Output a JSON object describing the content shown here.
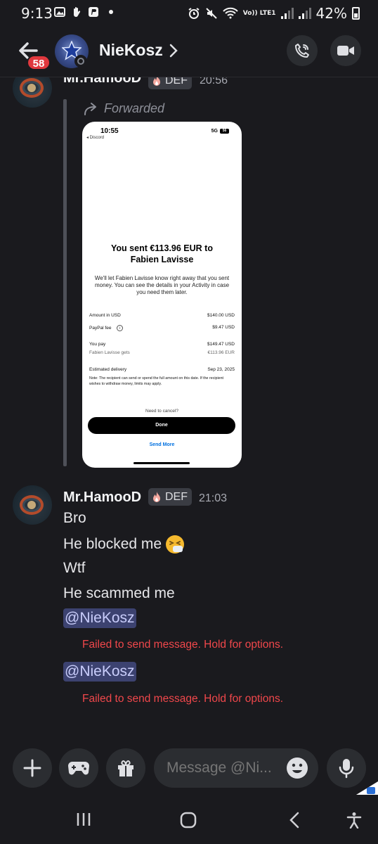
{
  "status_bar": {
    "time": "9:13",
    "battery": "42%",
    "network": "Vo)) LTE1"
  },
  "header": {
    "unread_count": "58",
    "channel_name": "NieKosz",
    "avatar_label": "NIEKOSZ"
  },
  "messages": [
    {
      "author": "Mr.HamooD",
      "role": "DEF",
      "time": "20:56",
      "forwarded_label": "Forwarded",
      "screenshot": {
        "time": "10:55",
        "back_app": "◂ Discord",
        "signal": "5G",
        "battery": "56",
        "title_line1": "You sent €113.96 EUR to",
        "title_line2": "Fabien Lavisse",
        "body": "We'll let Fabien Lavisse know right away that you sent money. You can see the details in your Activity in case you need them later.",
        "rows": [
          {
            "label": "Amount in USD",
            "value": "$140.00 USD"
          },
          {
            "label": "PayPal fee",
            "value": "$9.47 USD"
          },
          {
            "label": "You pay",
            "value": "$149.47 USD"
          },
          {
            "label": "Fabien Lavisse gets",
            "value": "€113.96 EUR"
          },
          {
            "label": "Estimated delivery",
            "value": "Sep 23, 2025"
          }
        ],
        "note": "Note: The recipient can send or spend the full amount on this date. If the recipient wishes to withdraw money, limits may apply.",
        "cancel_text": "Need to cancel?",
        "done_button": "Done",
        "send_more": "Send More"
      }
    },
    {
      "author": "Mr.HamooD",
      "role": "DEF",
      "time": "21:03",
      "lines": [
        "Bro",
        "He blocked me",
        "Wtf",
        "He scammed me"
      ],
      "mentions": [
        {
          "text": "@NieKosz",
          "error": "Failed to send message. Hold for options."
        },
        {
          "text": "@NieKosz",
          "error": "Failed to send message. Hold for options."
        }
      ]
    }
  ],
  "input": {
    "placeholder": "Message @Ni..."
  },
  "colors": {
    "background": "#1a1a1e",
    "badge_red": "#e0383e",
    "error_red": "#f0474b",
    "mention_bg": "#3c4270",
    "button_bg": "#2b2d31"
  },
  "icons": {
    "header": [
      "back-arrow-icon",
      "chevron-right-icon",
      "phone-call-icon",
      "video-camera-icon"
    ],
    "input": [
      "plus-icon",
      "gamepad-icon",
      "gift-icon",
      "emoji-icon",
      "microphone-icon"
    ],
    "nav": [
      "recent-apps-icon",
      "home-icon",
      "back-icon",
      "accessibility-icon"
    ]
  }
}
